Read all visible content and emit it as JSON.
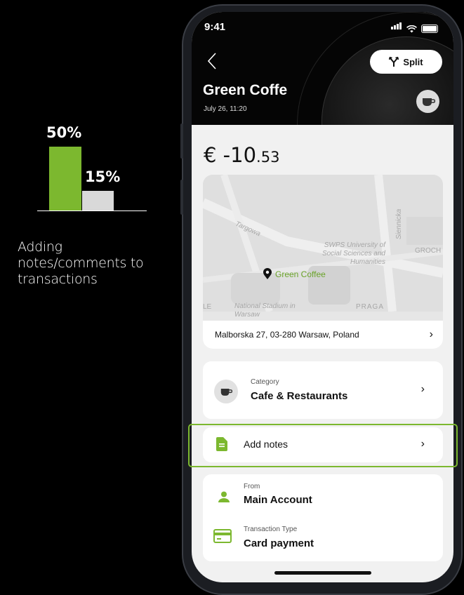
{
  "stats": {
    "bar_primary_label": "50%",
    "bar_primary_value": 50,
    "bar_secondary_label": "15%",
    "bar_secondary_value": 15,
    "caption": "Adding notes/comments to transactions",
    "colors": {
      "primary": "#7cb82f",
      "secondary": "#d9d9d9"
    }
  },
  "status_bar": {
    "time": "9:41"
  },
  "header": {
    "back_icon": "chevron-left-icon",
    "split_label": "Split",
    "split_icon": "split-arrows-icon",
    "merchant": "Green Coffe",
    "date": "July 26, 11:20",
    "category_icon": "coffee-cup-icon"
  },
  "amount": {
    "main": "€ -10",
    "cents": ".53"
  },
  "map": {
    "street_label": "Targowa",
    "university_label": "SWPS University of Social Sciences and Humanities",
    "stadium_label": "National Stadium in Warsaw",
    "praga_label": "PRAGA",
    "groch_label": "GROCH",
    "siennicka_label": "Siennicka",
    "le_label": "LE",
    "pin_label": "Green Coffee"
  },
  "address": {
    "text": "Malborska 27, 03-280 Warsaw, Poland"
  },
  "category": {
    "label": "Category",
    "value": "Cafe & Restaurants"
  },
  "notes": {
    "label": "Add notes"
  },
  "account": {
    "from_label": "From",
    "from_value": "Main Account",
    "type_label": "Transaction Type",
    "type_value": "Card payment"
  },
  "accent_color": "#7cb82f"
}
